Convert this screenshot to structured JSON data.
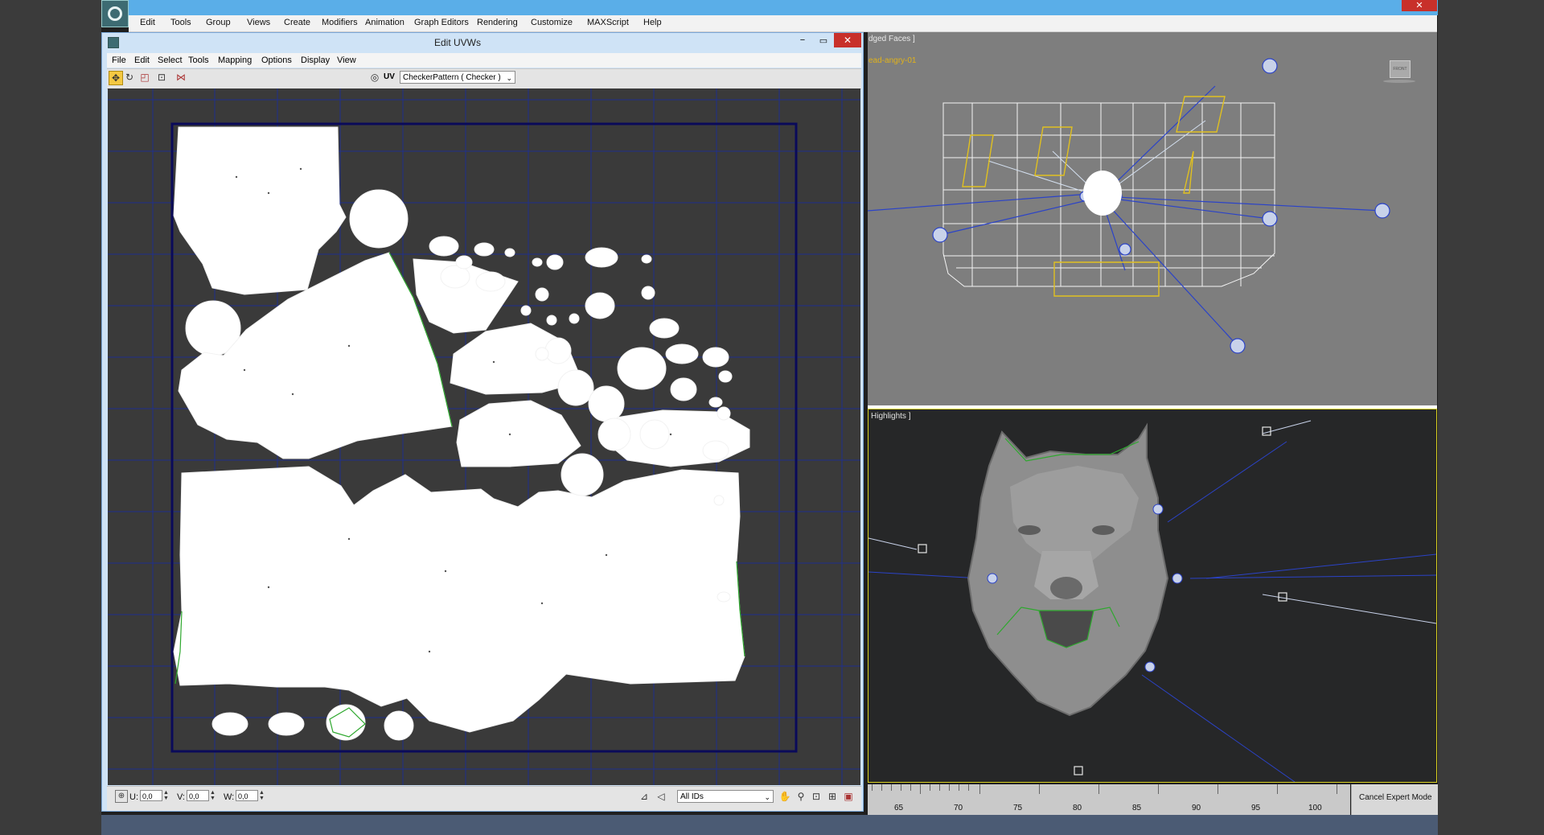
{
  "app": {
    "close_symbol": "✕",
    "logo_icon": "3dsmax-logo-icon"
  },
  "menu": [
    {
      "label": "Edit"
    },
    {
      "label": "Tools"
    },
    {
      "label": "Group"
    },
    {
      "label": "Views"
    },
    {
      "label": "Create"
    },
    {
      "label": "Modifiers"
    },
    {
      "label": "Animation"
    },
    {
      "label": "Graph Editors"
    },
    {
      "label": "Rendering"
    },
    {
      "label": "Customize"
    },
    {
      "label": "MAXScript"
    },
    {
      "label": "Help"
    }
  ],
  "uvw": {
    "title": "Edit UVWs",
    "min_symbol": "−",
    "max_symbol": "▭",
    "close_symbol": "✕",
    "menu": [
      {
        "label": "File"
      },
      {
        "label": "Edit"
      },
      {
        "label": "Select"
      },
      {
        "label": "Tools"
      },
      {
        "label": "Mapping"
      },
      {
        "label": "Options"
      },
      {
        "label": "Display"
      },
      {
        "label": "View"
      }
    ],
    "toolbar": {
      "uv_label": "UV",
      "checker_value": "CheckerPattern  ( Checker )",
      "dropdown_arrow": "⌄"
    },
    "status": {
      "u_label": "U:",
      "u_value": "0,0",
      "v_label": "V:",
      "v_value": "0,0",
      "w_label": "W:",
      "w_value": "0,0",
      "ids_value": "All IDs"
    }
  },
  "viewports": {
    "front_label": "dged Faces ]",
    "front_object": "ead-angry-01",
    "front_cube_label": "FRONT",
    "persp_label": "Highlights ]"
  },
  "timeline": {
    "numbers": [
      "65",
      "70",
      "75",
      "80",
      "85",
      "90",
      "95",
      "100"
    ],
    "expert_label": "Cancel Expert Mode"
  },
  "colors": {
    "title_bar": "#5aaee8",
    "uv_canvas": "#3a3a3a",
    "grid_line": "#1f2f8c",
    "selection_edge": "#2ea82e",
    "light_rig": "#2b43c8",
    "light_rig_highlight": "#e0c020"
  }
}
